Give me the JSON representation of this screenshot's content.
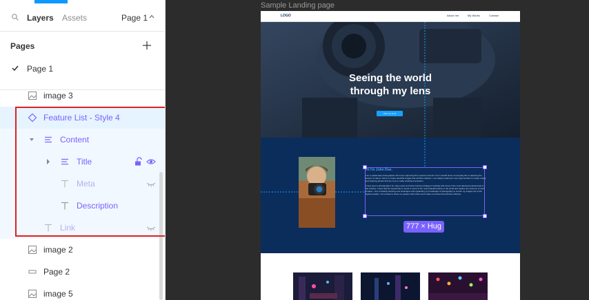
{
  "left_panel": {
    "tabs": {
      "layers": "Layers",
      "assets": "Assets"
    },
    "page_selector": "Page 1",
    "pages_header": "Pages",
    "pages": [
      {
        "label": "Page 1",
        "selected": true
      }
    ],
    "layers": [
      {
        "label": "image 3",
        "icon": "image-icon"
      },
      {
        "label": "Feature List - Style 4",
        "icon": "component-icon",
        "selected": true
      },
      {
        "label": "Content",
        "icon": "auto-layout-icon"
      },
      {
        "label": "Title",
        "icon": "auto-layout-icon"
      },
      {
        "label": "Meta",
        "icon": "text-icon",
        "hidden": true
      },
      {
        "label": "Description",
        "icon": "text-icon"
      },
      {
        "label": "Link",
        "icon": "text-icon",
        "hidden": true
      },
      {
        "label": "image 2",
        "icon": "image-icon"
      },
      {
        "label": "Page 2",
        "icon": "frame-icon"
      },
      {
        "label": "image 5",
        "icon": "image-icon"
      }
    ]
  },
  "canvas": {
    "frame_label": "Sample Landing page",
    "nav": {
      "logo": "LOGO",
      "links": [
        "About me",
        "My Works",
        "Contact"
      ]
    },
    "hero": {
      "title_line1": "Seeing the world",
      "title_line2": "through my lens",
      "button": "View my work"
    },
    "about": {
      "heading": "Hi I'm John Doe.",
      "paragraph1": "I am a passionate photographer who loves capturing life's special moments. From candid shots of everyday life to capturing the beauty of nature I strive to create beautiful images that will last a lifetime. I am always looking for new opportunities to create unique and inspiring photos that are sure to make a lasting impression.",
      "paragraph2": "I have been a photographer for many years and have had the privilege of working with some of the most talented professionals in the industry. I have had the opportunity to travel to some of the most beautiful places in the world and capture the essence of each location. I am constantly learning new techniques and expanding my knowledge of photography to ensure my images are of the highest quality. I am excited to share my passion with others and create memories that will last a lifetime."
    },
    "size_indicator": "777 × Hug"
  },
  "colors": {
    "accent_blue": "#0d99ff",
    "component_purple": "#7b61ff",
    "selection_red": "#e02020",
    "dark_navy": "#0b2d5b"
  }
}
